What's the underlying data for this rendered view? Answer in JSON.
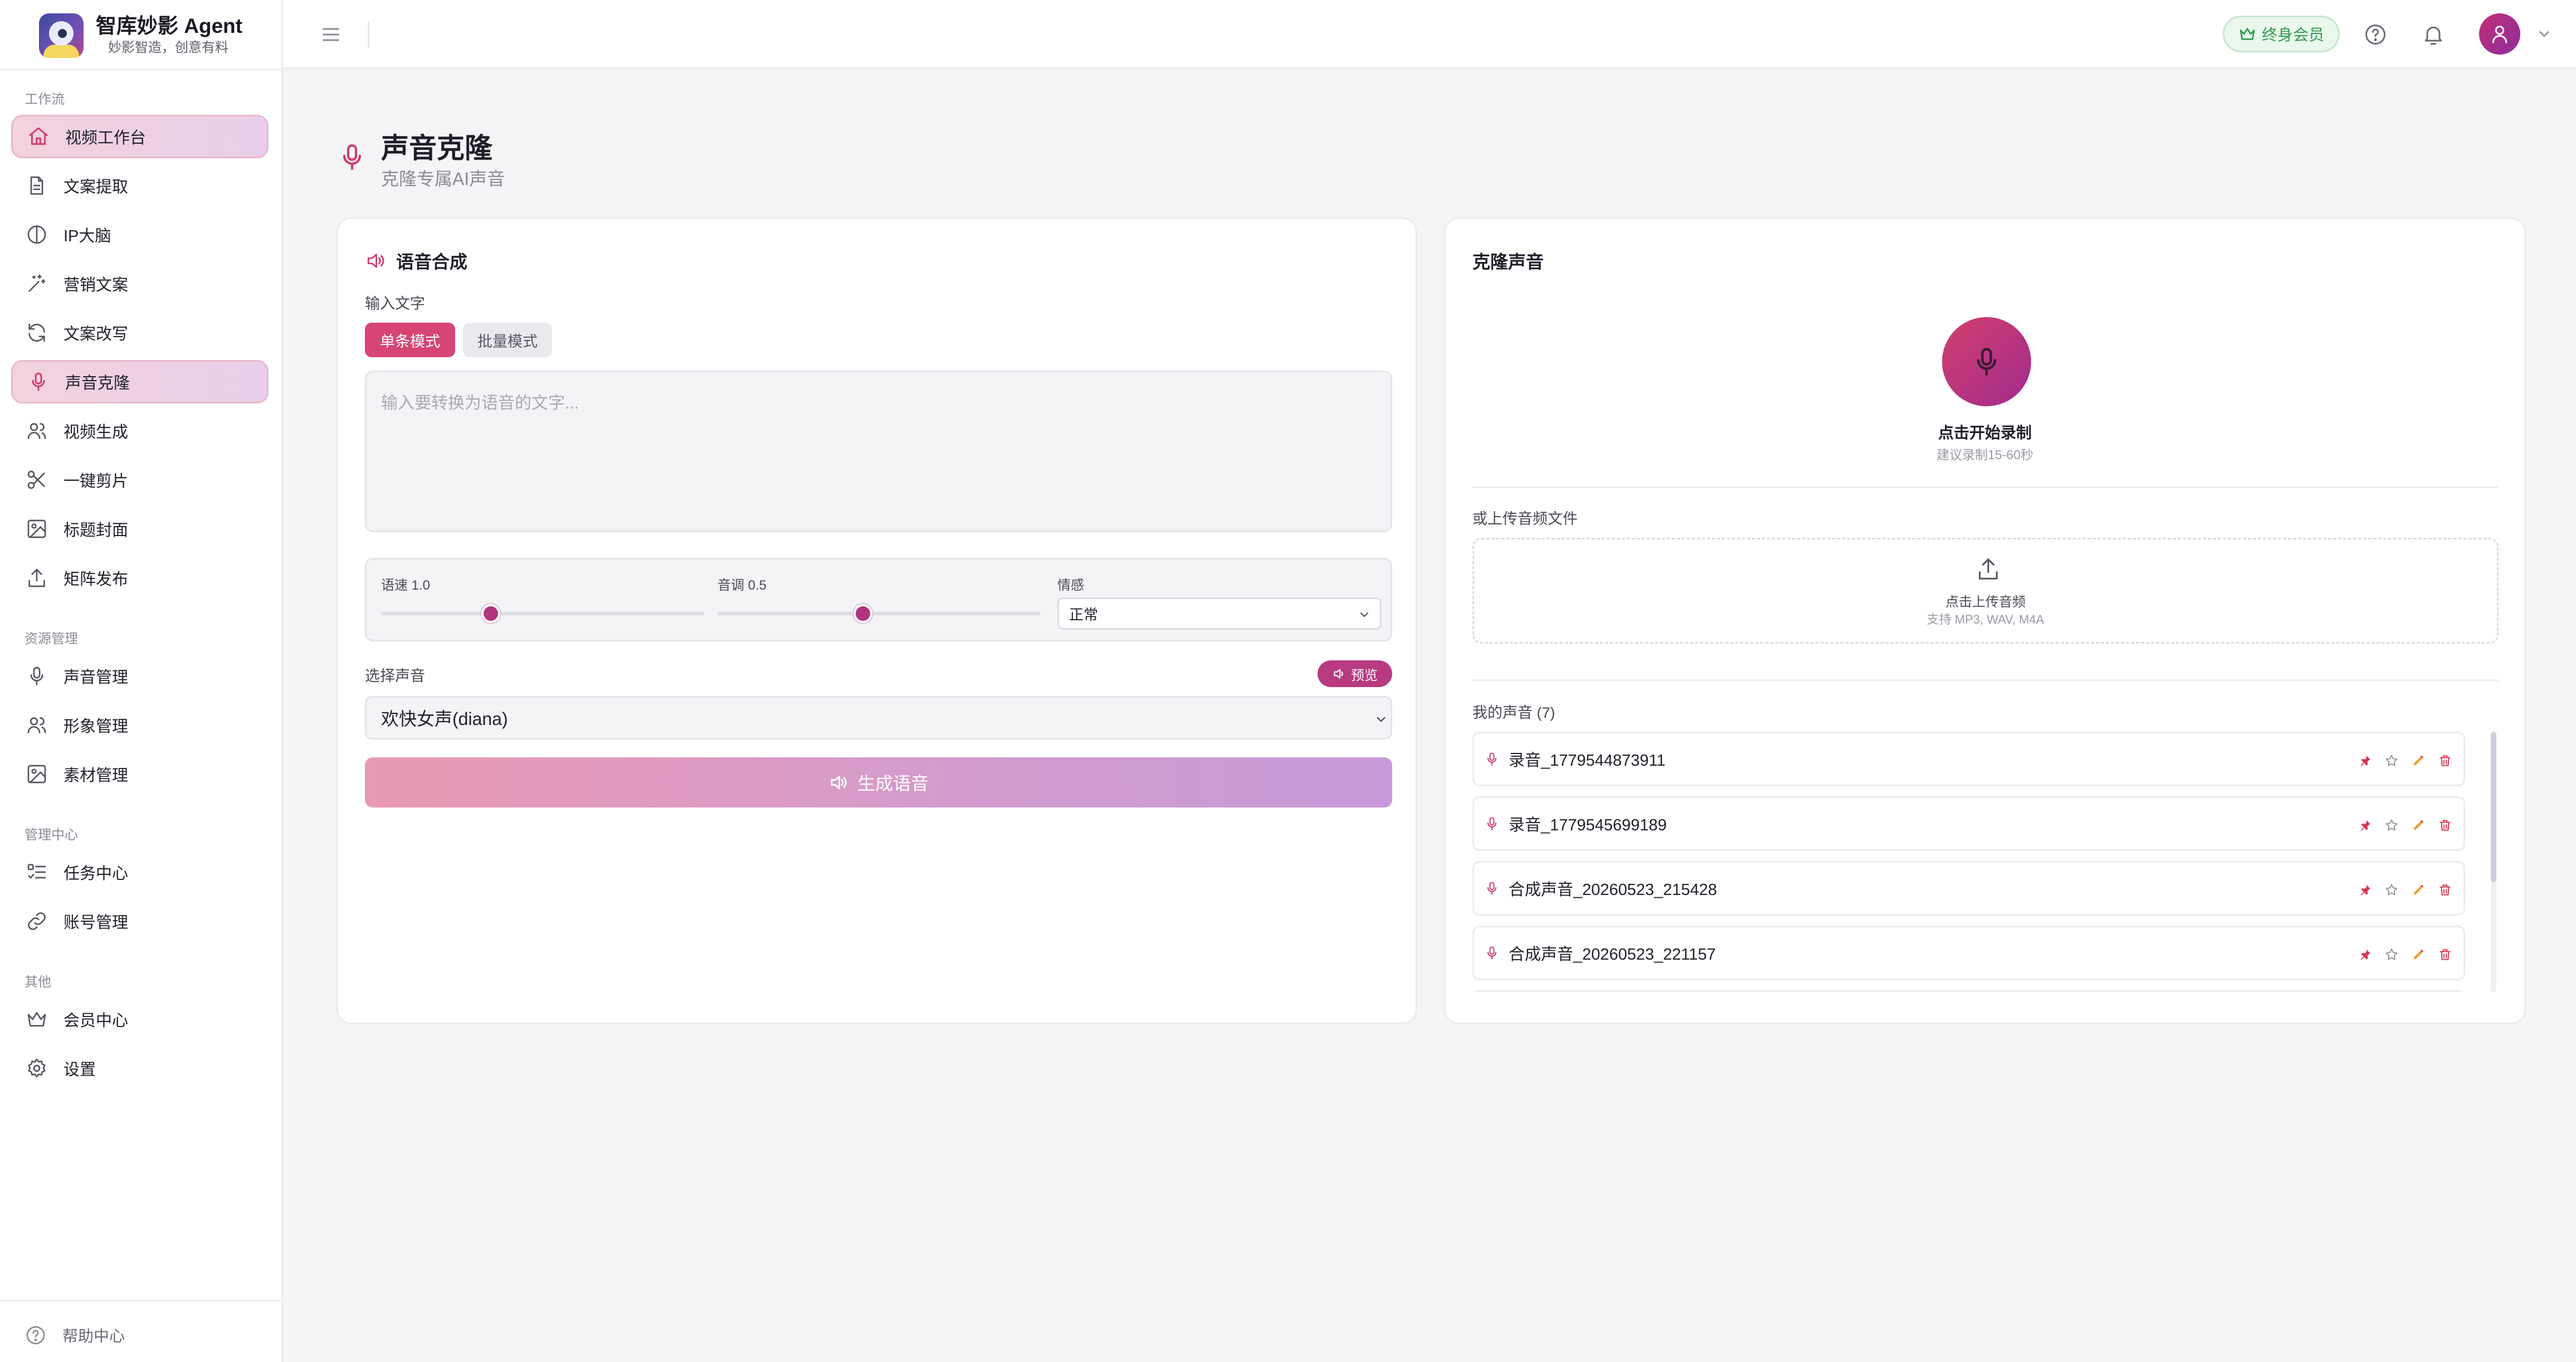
{
  "brand": {
    "title": "智库妙影 Agent",
    "subtitle": "妙影智造，创意有料"
  },
  "sidebar": {
    "groups": [
      {
        "label": "工作流"
      },
      {
        "label": "资源管理"
      },
      {
        "label": "管理中心"
      },
      {
        "label": "其他"
      }
    ],
    "items": [
      {
        "label": "视频工作台",
        "icon": "home-icon"
      },
      {
        "label": "文案提取",
        "icon": "document-icon"
      },
      {
        "label": "IP大脑",
        "icon": "brain-icon"
      },
      {
        "label": "营销文案",
        "icon": "sparkle-icon"
      },
      {
        "label": "文案改写",
        "icon": "refresh-icon"
      },
      {
        "label": "声音克隆",
        "icon": "microphone-icon"
      },
      {
        "label": "视频生成",
        "icon": "users-icon"
      },
      {
        "label": "一键剪片",
        "icon": "scissors-icon"
      },
      {
        "label": "标题封面",
        "icon": "image-icon"
      },
      {
        "label": "矩阵发布",
        "icon": "upload-icon"
      },
      {
        "label": "声音管理",
        "icon": "microphone-icon"
      },
      {
        "label": "形象管理",
        "icon": "users-icon"
      },
      {
        "label": "素材管理",
        "icon": "image-icon"
      },
      {
        "label": "任务中心",
        "icon": "task-list-icon"
      },
      {
        "label": "账号管理",
        "icon": "link-icon"
      },
      {
        "label": "会员中心",
        "icon": "crown-icon"
      },
      {
        "label": "设置",
        "icon": "gear-icon"
      }
    ],
    "active": "声音克隆",
    "help": "帮助中心"
  },
  "topbar": {
    "vip_label": "终身会员"
  },
  "page": {
    "title": "声音克隆",
    "subtitle": "克隆专属AI声音"
  },
  "synthesis": {
    "title": "语音合成",
    "input_label": "输入文字",
    "mode_single": "单条模式",
    "mode_batch": "批量模式",
    "placeholder": "输入要转换为语音的文字...",
    "speed_label": "语速 1.0",
    "speed_value": 1.0,
    "speed_fraction": 0.34,
    "pitch_label": "音调 0.5",
    "pitch_value": 0.5,
    "pitch_fraction": 0.45,
    "emotion_label": "情感",
    "emotion_value": "正常",
    "voice_label": "选择声音",
    "preview_label": "预览",
    "voice_value": "欢快女声(diana)",
    "generate_label": "生成语音"
  },
  "clone": {
    "title": "克隆声音",
    "record_title": "点击开始录制",
    "record_hint": "建议录制15-60秒",
    "upload_label": "或上传音频文件",
    "upload_title": "点击上传音频",
    "upload_formats": "支持 MP3, WAV, M4A",
    "my_voices_label": "我的声音 (7)",
    "voices": [
      {
        "name": "录音_1779544873911"
      },
      {
        "name": "录音_1779545699189"
      },
      {
        "name": "合成声音_20260523_215428"
      },
      {
        "name": "合成声音_20260523_221157"
      },
      {
        "name": ""
      }
    ]
  },
  "colors": {
    "accent": "#d64573",
    "accent_purple": "#b1347f",
    "vip_green": "#2e9a4e",
    "active_bg": "#f3d2de"
  }
}
